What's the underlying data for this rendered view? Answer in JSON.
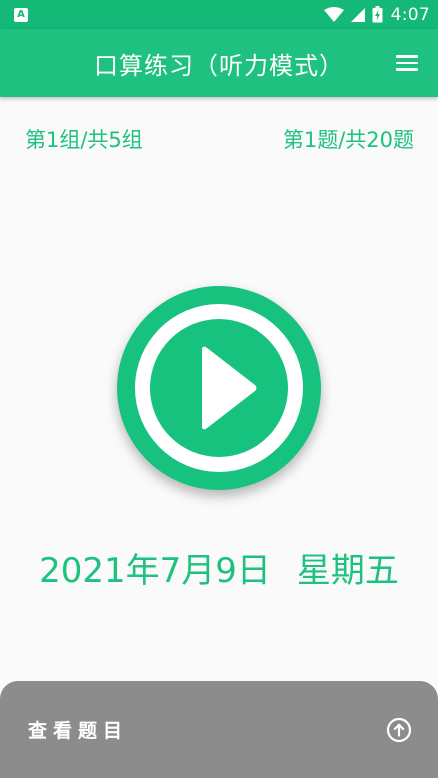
{
  "status_bar": {
    "time": "4:07",
    "android_badge": "A"
  },
  "app_bar": {
    "title": "口算练习（听力模式）"
  },
  "progress": {
    "group": "第1组/共5组",
    "question": "第1题/共20题"
  },
  "date": {
    "day": "2021年7月9日",
    "weekday": "星期五"
  },
  "bottom_sheet": {
    "label": "查看题目"
  },
  "colors": {
    "status_bar": "#14b877",
    "app_bar": "#1ec17f",
    "accent": "#17c27f",
    "sheet": "#8c8c8c",
    "background": "#fafafa"
  },
  "icons": {
    "menu": "hamburger-menu-icon",
    "play": "play-icon",
    "expand": "arrow-up-circle-icon"
  }
}
